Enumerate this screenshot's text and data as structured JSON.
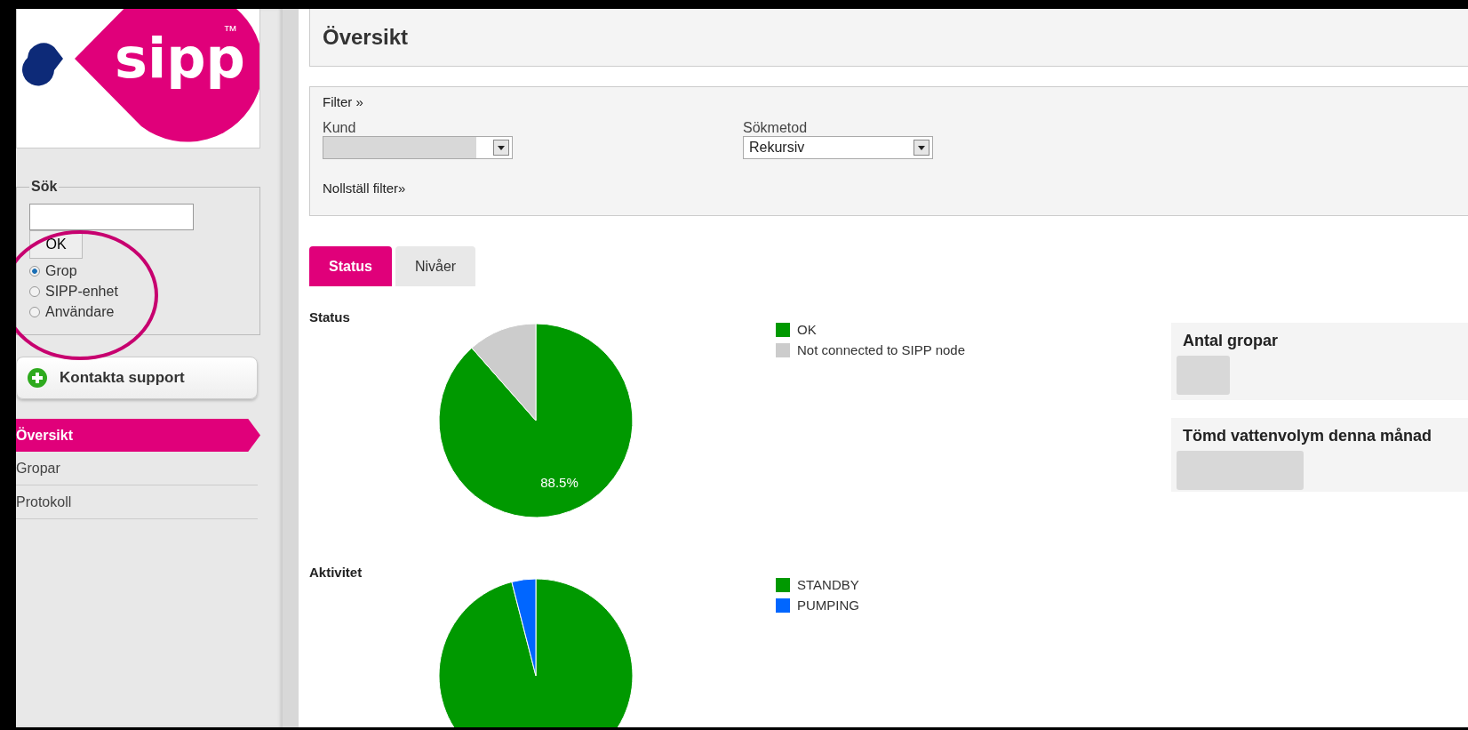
{
  "logo": {
    "text": "sipp",
    "mark": "™"
  },
  "search": {
    "legend": "Sök",
    "button": "OK",
    "options": [
      {
        "label": "Grop",
        "selected": true
      },
      {
        "label": "SIPP-enhet",
        "selected": false
      },
      {
        "label": "Användare",
        "selected": false
      }
    ]
  },
  "support_button": "Kontakta support",
  "nav": [
    {
      "label": "Översikt",
      "selected": true
    },
    {
      "label": "Gropar",
      "selected": false
    },
    {
      "label": "Protokoll",
      "selected": false
    }
  ],
  "page_title": "Översikt",
  "filter": {
    "title": "Filter »",
    "fields": [
      {
        "label": "Kund"
      },
      {
        "label": "Sökmetod",
        "value": "Rekursiv"
      }
    ],
    "reset": "Nollställ filter»"
  },
  "tabs": [
    {
      "label": "Status",
      "selected": true
    },
    {
      "label": "Nivåer",
      "selected": false
    }
  ],
  "charts": [
    {
      "chart_data": {
        "type": "pie",
        "title": "Status",
        "legend": "right",
        "categories": [
          "OK",
          "Not connected to SIPP node"
        ],
        "series": [
          {
            "values": [
              88.5,
              11.5
            ]
          }
        ],
        "colors": [
          "#009900",
          "#cccccc"
        ],
        "value_labels": [
          "88.5%",
          null
        ]
      }
    },
    {
      "chart_data": {
        "type": "pie",
        "title": "Aktivitet",
        "legend": "right",
        "categories": [
          "STANDBY",
          "PUMPING"
        ],
        "series": [
          {
            "values": [
              96,
              4
            ]
          }
        ],
        "colors": [
          "#009900",
          "#0066ff"
        ]
      }
    }
  ],
  "cards": [
    {
      "title": "Antal gropar"
    },
    {
      "title": "Tömd vattenvolym denna månad"
    }
  ]
}
